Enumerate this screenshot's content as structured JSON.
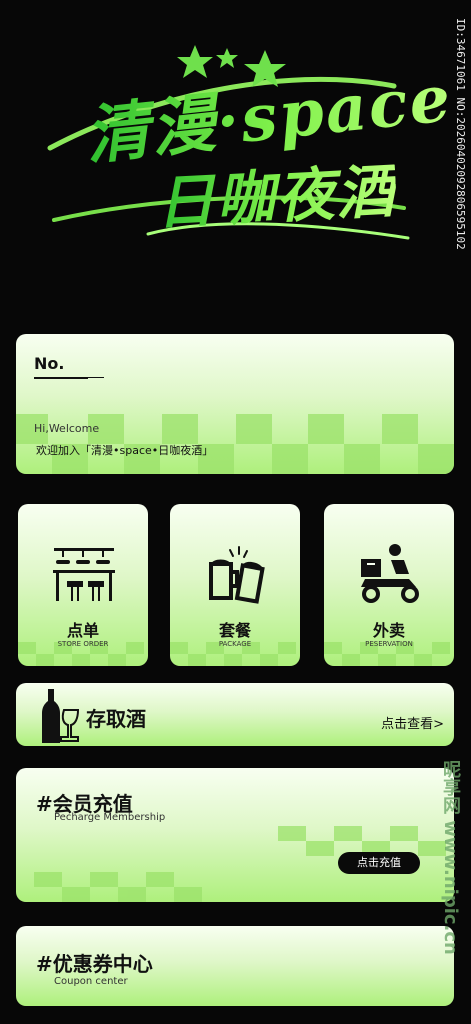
{
  "brand": {
    "line1": "清漫·space",
    "line2": "日咖夜酒"
  },
  "side_id": "ID:34671061 NO:20260402092806595102",
  "member_card": {
    "no_label": "No.",
    "welcome": "Hi,Welcome",
    "join_text": "欢迎加入「清漫•space•日咖夜酒」"
  },
  "tiles": [
    {
      "label": "点单",
      "sub": "STORE ORDER",
      "icon": "bar-counter-icon"
    },
    {
      "label": "套餐",
      "sub": "PACKAGE",
      "icon": "beer-mugs-icon"
    },
    {
      "label": "外卖",
      "sub": "PESERVATION",
      "icon": "delivery-scooter-icon"
    }
  ],
  "storage": {
    "title": "存取酒",
    "link": "点击查看>"
  },
  "recharge": {
    "title": "#会员充值",
    "sub": "Pecharge Membership",
    "button": "点击充值"
  },
  "coupon": {
    "title": "#优惠券中心",
    "sub": "Coupon center"
  },
  "watermark": "昵享网 www.nipic.cn",
  "colors": {
    "background": "#070707",
    "brand_green": "#6fe04c",
    "card_light": "#f8fff1",
    "card_green": "#aef07c",
    "text": "#111111"
  }
}
